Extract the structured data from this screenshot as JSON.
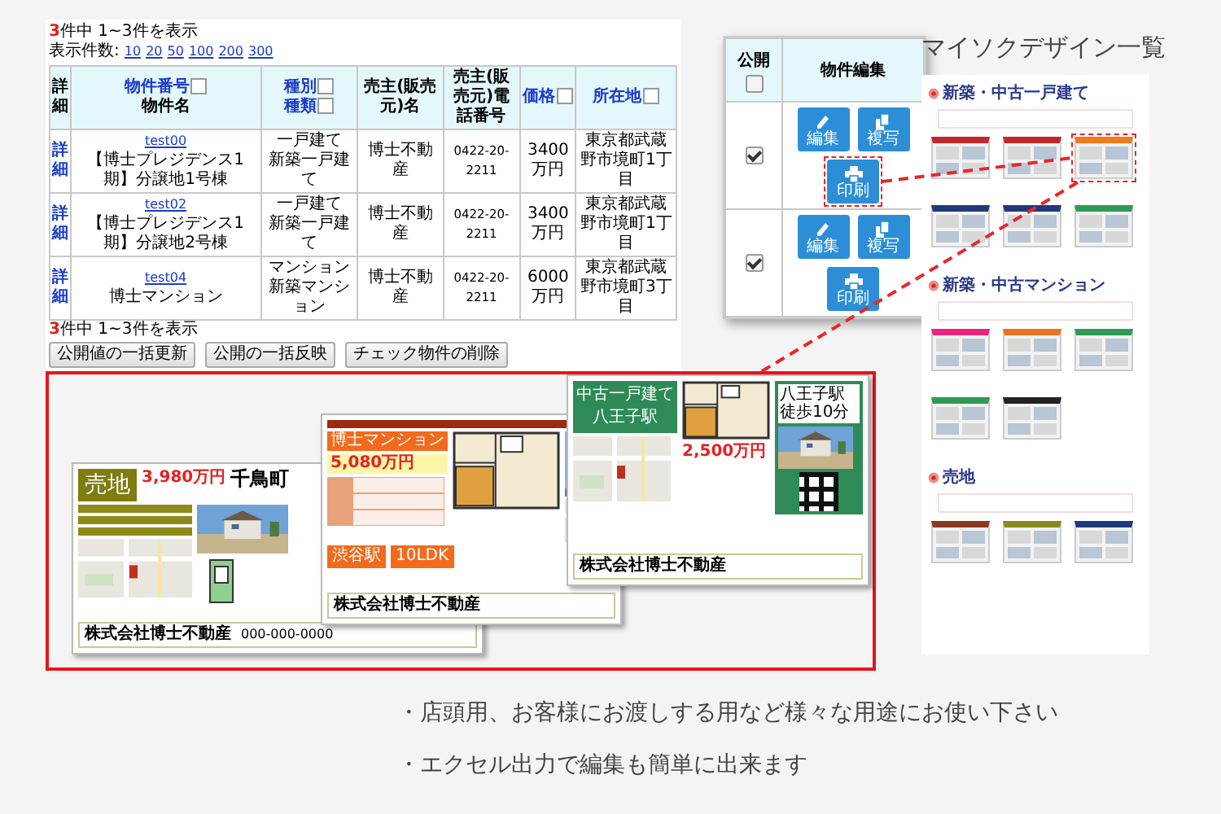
{
  "listing": {
    "count_top": {
      "number": "3",
      "text": "件中 1~3件を表示"
    },
    "per_page": {
      "label": "表示件数:",
      "options": [
        "10",
        "20",
        "50",
        "100",
        "200",
        "300"
      ]
    },
    "columns": [
      {
        "lines": [
          {
            "text": "詳細",
            "link": false
          }
        ]
      },
      {
        "lines": [
          {
            "text": "物件番号",
            "link": true,
            "sort_icon": true
          },
          {
            "text": "物件名",
            "link": false
          }
        ]
      },
      {
        "lines": [
          {
            "text": "種別",
            "link": true,
            "sort_icon": true
          },
          {
            "text": "種類",
            "link": true,
            "sort_icon": true
          }
        ]
      },
      {
        "lines": [
          {
            "text": "売主(販売元)名",
            "link": false
          }
        ]
      },
      {
        "lines": [
          {
            "text": "売主(販売元)電話番号",
            "link": false
          }
        ]
      },
      {
        "lines": [
          {
            "text": "価格",
            "link": true,
            "sort_icon": true
          }
        ]
      },
      {
        "lines": [
          {
            "text": "所在地",
            "link": true,
            "sort_icon": true
          }
        ]
      }
    ],
    "rows": [
      {
        "detail": "詳細",
        "number": "test00",
        "name": "【博士プレジデンス1期】分譲地1号棟",
        "type": "一戸建て",
        "subtype": "新築一戸建て",
        "seller": "博士不動産",
        "phone": "0422-20-2211",
        "price": "3400万円",
        "address": "東京都武蔵野市境町1丁目"
      },
      {
        "detail": "詳細",
        "number": "test02",
        "name": "【博士プレジデンス1期】分譲地2号棟",
        "type": "一戸建て",
        "subtype": "新築一戸建て",
        "seller": "博士不動産",
        "phone": "0422-20-2211",
        "price": "3400万円",
        "address": "東京都武蔵野市境町1丁目"
      },
      {
        "detail": "詳細",
        "number": "test04",
        "name": "博士マンション",
        "type": "マンション",
        "subtype": "新築マンション",
        "seller": "博士不動産",
        "phone": "0422-20-2211",
        "price": "6000万円",
        "address": "東京都武蔵野市境町3丁目"
      }
    ],
    "count_bottom": {
      "number": "3",
      "text": "件中 1~3件を表示"
    },
    "buttons": [
      "公開値の一括更新",
      "公開の一括反映",
      "チェック物件の削除"
    ]
  },
  "edit_panel": {
    "columns": [
      "公開",
      "物件編集"
    ],
    "all_checked": false,
    "rows": [
      {
        "published": true,
        "actions": [
          {
            "kind": "edit",
            "label": "編集",
            "highlighted": false
          },
          {
            "kind": "copy",
            "label": "複写",
            "highlighted": false
          },
          {
            "kind": "print",
            "label": "印刷",
            "highlighted": true
          }
        ]
      },
      {
        "published": true,
        "actions": [
          {
            "kind": "edit",
            "label": "編集",
            "highlighted": false
          },
          {
            "kind": "copy",
            "label": "複写",
            "highlighted": false
          },
          {
            "kind": "print",
            "label": "印刷",
            "highlighted": false
          }
        ]
      }
    ]
  },
  "flyers": [
    {
      "kind": "land",
      "category": "売地",
      "price": "3,980万円",
      "town": "千鳥町",
      "company": "株式会社博士不動産",
      "phone": "000-000-0000"
    },
    {
      "kind": "mansion",
      "name": "博士マンション",
      "price": "5,080万円",
      "station": "渋谷駅",
      "layout": "10LDK",
      "company": "株式会社博士不動産"
    },
    {
      "kind": "house",
      "category": "中古一戸建て",
      "station": "八王子駅",
      "access_station": "八王子駅",
      "access_walk": "徒歩10分",
      "price": "2,500万円",
      "company": "株式会社博士不動産"
    }
  ],
  "gallery": {
    "title": "マイソクデザイン一覧",
    "sections": [
      {
        "heading": "新築・中古一戸建て",
        "thumbnails": [
          {
            "color": "#c0282d",
            "highlighted": false
          },
          {
            "color": "#c0282d",
            "highlighted": false
          },
          {
            "color": "#f07a1e",
            "highlighted": true
          },
          {
            "color": "#1f3a7a",
            "highlighted": false
          },
          {
            "color": "#1f3a7a",
            "highlighted": false
          },
          {
            "color": "#2e9a55",
            "highlighted": false
          }
        ]
      },
      {
        "heading": "新築・中古マンション",
        "thumbnails": [
          {
            "color": "#e8247c",
            "highlighted": false
          },
          {
            "color": "#e8741e",
            "highlighted": false
          },
          {
            "color": "#2e9a55",
            "highlighted": false
          },
          {
            "color": "#2e9a55",
            "highlighted": false
          },
          {
            "color": "#222222",
            "highlighted": false
          }
        ]
      },
      {
        "heading": "売地",
        "thumbnails": [
          {
            "color": "#8a3a1e",
            "highlighted": false
          },
          {
            "color": "#8a8a1e",
            "highlighted": false
          },
          {
            "color": "#1f3a7a",
            "highlighted": false
          }
        ]
      }
    ]
  },
  "notes": [
    "・店頭用、お客様にお渡しする用など様々な用途にお使い下さい",
    "・エクセル出力で編集も簡単に出来ます"
  ]
}
